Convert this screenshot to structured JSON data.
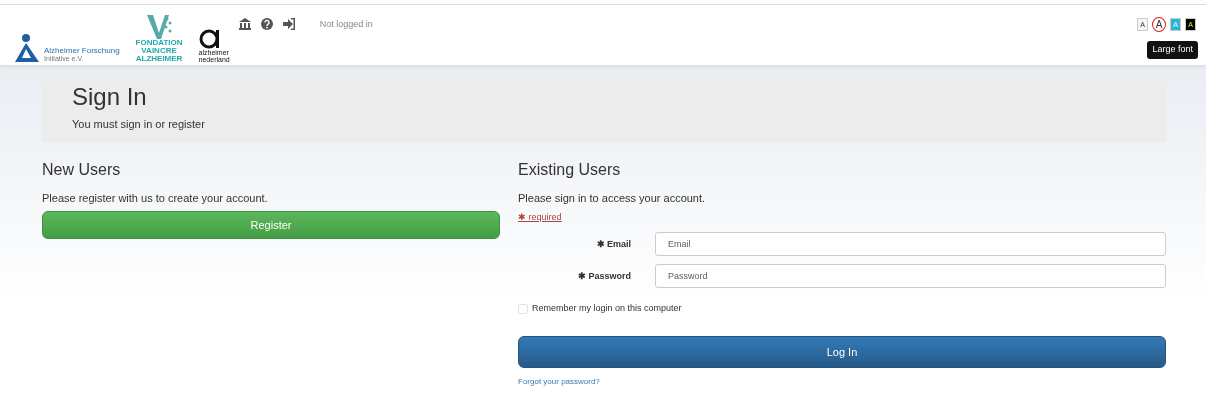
{
  "header": {
    "logos": [
      {
        "kind": "afi",
        "lines": [
          "Alzheimer Forschung",
          "Initiative e.V."
        ]
      },
      {
        "kind": "va",
        "lines": [
          "FONDATION",
          "VAINCRE",
          "ALZHEIMER"
        ]
      },
      {
        "kind": "an",
        "lines": [
          "alzheimer",
          "nederland"
        ]
      }
    ],
    "status": "Not logged in",
    "font_buttons": [
      {
        "label": "A",
        "kind": "normal",
        "selected": false
      },
      {
        "label": "A",
        "kind": "large",
        "selected": true
      },
      {
        "label": "A",
        "kind": "cyan",
        "selected": false
      },
      {
        "label": "A",
        "kind": "dark",
        "selected": false
      }
    ],
    "tooltip": "Large font"
  },
  "hero": {
    "title": "Sign In",
    "subtitle": "You must sign in or register"
  },
  "new_users": {
    "heading": "New Users",
    "text": "Please register with us to create your account.",
    "button": "Register"
  },
  "existing_users": {
    "heading": "Existing Users",
    "text": "Please sign in to access your account.",
    "required_mark": "✱",
    "required": "required",
    "fields": [
      {
        "label": "Email",
        "placeholder": "Email"
      },
      {
        "label": "Password",
        "placeholder": "Password"
      }
    ],
    "remember": {
      "label": "Remember my login on this computer",
      "checked": false
    },
    "button": "Log In",
    "forgot": "Forgot your password?"
  }
}
